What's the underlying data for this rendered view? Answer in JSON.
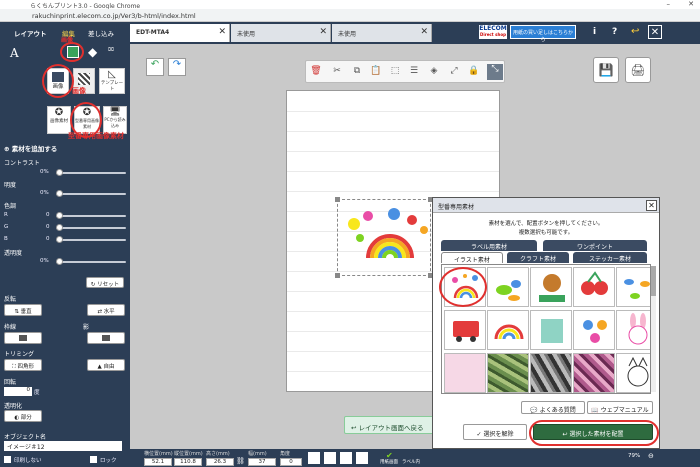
{
  "window": {
    "title": "らくちんプリント3.0 - Google Chrome",
    "url": "rakuchinprint.elecom.co.jp/Ver3/b-html/index.html"
  },
  "header": {
    "tabs": [
      "レイアウト",
      "編集",
      "差し込み"
    ],
    "brand": "ELECOM",
    "brand_sub": "Direct shop",
    "promo": "用紙の買い足しはこちらから",
    "icons": [
      "info-icon",
      "help-icon",
      "undo-icon",
      "close-icon"
    ]
  },
  "doc_tabs": [
    {
      "label": "EDT-MTA4",
      "active": true
    },
    {
      "label": "未使用",
      "active": false
    },
    {
      "label": "未使用",
      "active": false
    }
  ],
  "left": {
    "top_icons": [
      "A",
      "画像",
      "図形"
    ],
    "annotation_red_1": "画像",
    "tiles_row1": [
      "画像",
      "パターン",
      "テンプレート"
    ],
    "annotation_red_2": "画像",
    "tiles_row2": [
      "画像素材",
      "型番専用画像素材",
      "PCから読み込み"
    ],
    "annotation_red_3": "型番専用画像素材",
    "add_material": "素材を追加する",
    "contrast_label": "コントラスト",
    "contrast_val": "0%",
    "brightness_label": "明度",
    "brightness_val": "0%",
    "color_label": "色調",
    "color_channels": [
      {
        "ch": "R",
        "val": "0"
      },
      {
        "ch": "G",
        "val": "0"
      },
      {
        "ch": "B",
        "val": "0"
      }
    ],
    "transparency_label": "透明度",
    "transparency_val": "0%",
    "reset": "リセット",
    "flip_label": "反転",
    "flip_v": "垂直",
    "flip_h": "水平",
    "outline_label": "枠線",
    "shadow_label": "影",
    "trim_label": "トリミング",
    "trim_free": "自由",
    "trim_square": "四角形",
    "rotate_label": "回転",
    "rotate_val": "0",
    "rotate_unit": "度",
    "opacity_label": "透明化",
    "opacity_btn": "部分",
    "object_label": "オブジェクト名",
    "object_name": "イメージ＃12",
    "print_none": "印刷しない",
    "lock": "ロック"
  },
  "dialog": {
    "title": "型番専用素材",
    "desc1": "素材を選んで、配置ボタンを押してください。",
    "desc2": "複数選択も可能です。",
    "tabs_back": [
      "ラベル用素材",
      "ワンポイント"
    ],
    "tabs_front": [
      "イラスト素材",
      "クラフト素材",
      "ステッカー素材"
    ],
    "active_tab": "イラスト素材",
    "faq": "よくある質問",
    "manual": "ウェブマニュアル",
    "deselect": "選択を解除",
    "place": "選択した素材を配置"
  },
  "layout_btn": "レイアウト画面へ戻る",
  "statusbar": {
    "fields": [
      {
        "label": "横位置(mm)",
        "val": "52.1"
      },
      {
        "label": "縦位置(mm)",
        "val": "110.8"
      },
      {
        "label": "高さ(mm)",
        "val": "26.3"
      },
      {
        "label": "幅(mm)",
        "val": "37"
      },
      {
        "label": "角度",
        "val": "0"
      }
    ],
    "labels": [
      "用紙画面",
      "ラベル内"
    ],
    "zoom": "79%"
  }
}
